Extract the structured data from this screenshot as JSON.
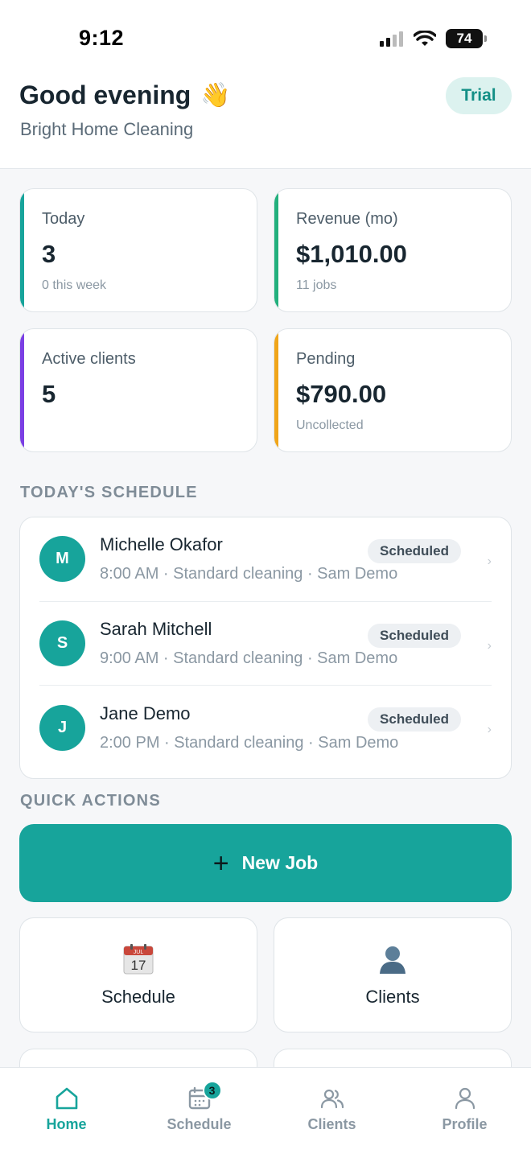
{
  "status_bar": {
    "time": "9:12",
    "battery": "74"
  },
  "header": {
    "greeting": "Good evening",
    "greeting_emoji": "👋",
    "business_name": "Bright Home Cleaning",
    "plan_badge": "Trial"
  },
  "stats": [
    {
      "label": "Today",
      "value": "3",
      "sub": "0 this week",
      "accent": "#17a49b"
    },
    {
      "label": "Revenue (mo)",
      "value": "$1,010.00",
      "sub": "11 jobs",
      "accent": "#22b07d"
    },
    {
      "label": "Active clients",
      "value": "5",
      "sub": "",
      "accent": "#7b3fe4"
    },
    {
      "label": "Pending",
      "value": "$790.00",
      "sub": "Uncollected",
      "accent": "#f0a51a"
    }
  ],
  "schedule": {
    "title": "TODAY'S SCHEDULE",
    "jobs": [
      {
        "initial": "M",
        "name": "Michelle Okafor",
        "meta": "8:00 AM · Standard cleaning · Sam Demo",
        "status": "Scheduled"
      },
      {
        "initial": "S",
        "name": "Sarah Mitchell",
        "meta": "9:00 AM · Standard cleaning · Sam Demo",
        "status": "Scheduled"
      },
      {
        "initial": "J",
        "name": "Jane Demo",
        "meta": "2:00 PM · Standard cleaning · Sam Demo",
        "status": "Scheduled"
      }
    ]
  },
  "quick_actions": {
    "title": "QUICK ACTIONS",
    "new_job": "New Job",
    "items": [
      {
        "label": "Schedule",
        "icon": "calendar-icon",
        "calendar_month": "JUL",
        "calendar_day": "17"
      },
      {
        "label": "Clients",
        "icon": "person-silhouette-icon"
      }
    ]
  },
  "tabbar": {
    "tabs": [
      {
        "label": "Home",
        "icon": "home-icon",
        "active": true
      },
      {
        "label": "Schedule",
        "icon": "calendar-icon",
        "badge": "3"
      },
      {
        "label": "Clients",
        "icon": "users-icon"
      },
      {
        "label": "Profile",
        "icon": "user-icon"
      }
    ]
  },
  "colors": {
    "brand": "#17a49b",
    "text": "#182630",
    "muted": "#8b98a3"
  }
}
